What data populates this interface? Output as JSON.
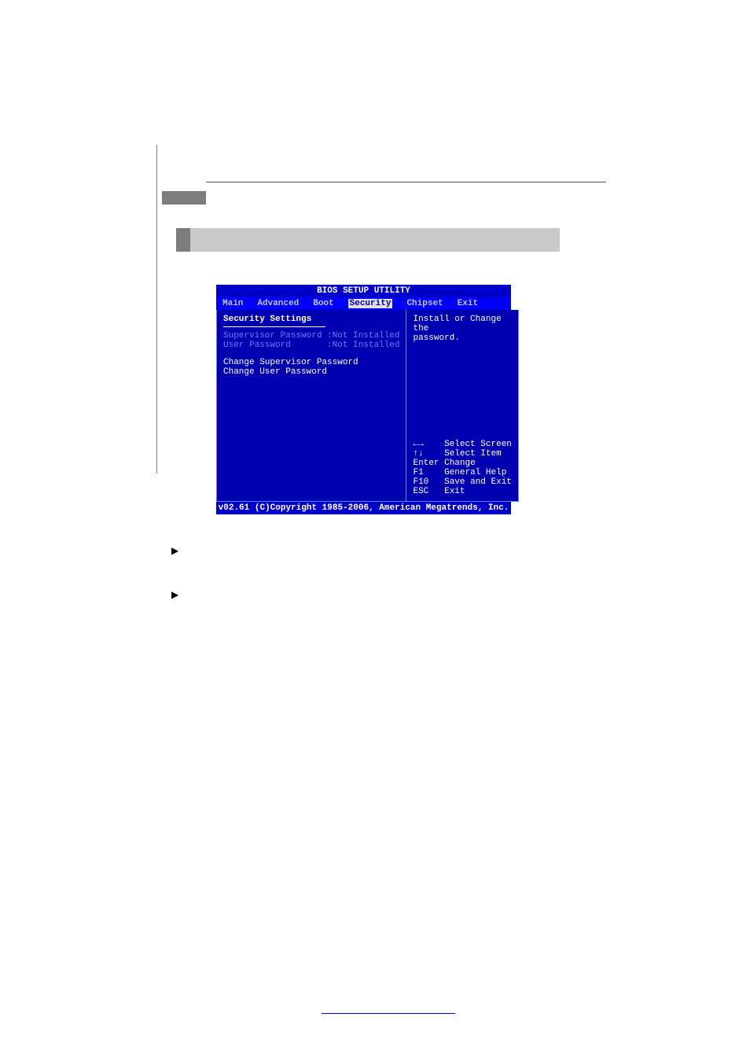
{
  "bios": {
    "title": "BIOS SETUP UTILITY",
    "menu": {
      "main": "Main",
      "advanced": "Advanced",
      "boot": "Boot",
      "security": "Security",
      "chipset": "Chipset",
      "exit": "Exit"
    },
    "left": {
      "section": "Security Settings",
      "supervisor_label": "Supervisor Password",
      "supervisor_value": ":Not Installed",
      "user_label": "User Password",
      "user_value": ":Not Installed",
      "change_supervisor": "Change Supervisor Password",
      "change_user": "Change User Password"
    },
    "right": {
      "help1": "Install or Change the",
      "help2": "password.",
      "nav": {
        "lr": "←→",
        "lr_desc": "Select Screen",
        "ud": "↑↓",
        "ud_desc": "Select Item",
        "enter": "Enter",
        "enter_desc": "Change",
        "f1": "F1",
        "f1_desc": "General Help",
        "f10": "F10",
        "f10_desc": "Save and Exit",
        "esc": "ESC",
        "esc_desc": "Exit"
      }
    },
    "footer": "v02.61 (C)Copyright 1985-2006, American Megatrends, Inc."
  }
}
